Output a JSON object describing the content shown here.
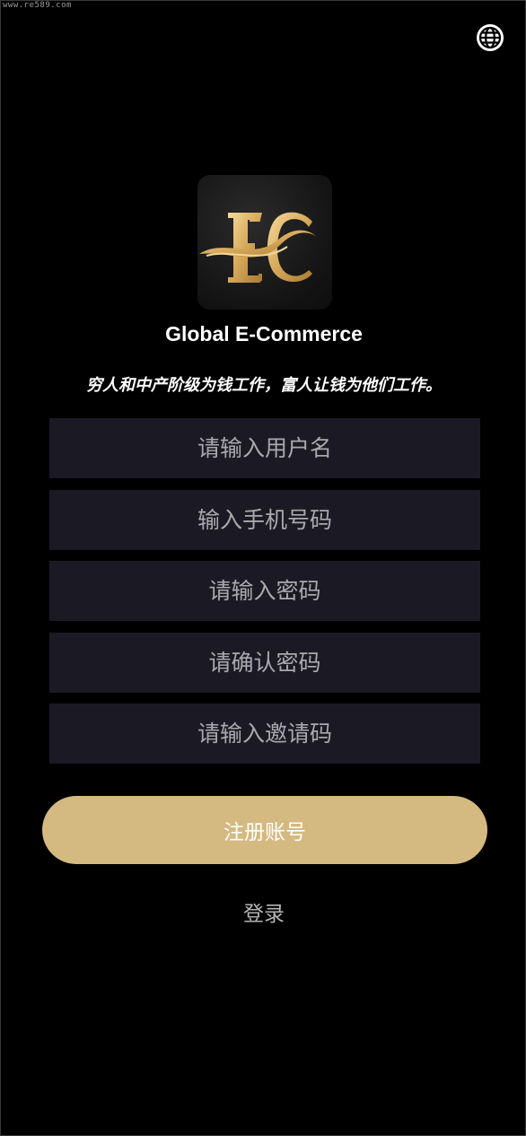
{
  "watermark": "www.re589.com",
  "header": {
    "language_icon": "globe-icon"
  },
  "app": {
    "logo_icon": "ec-logo",
    "logo_text": "EC",
    "name": "Global E-Commerce",
    "slogan": "穷人和中产阶级为钱工作，富人让钱为他们工作。"
  },
  "form": {
    "username": {
      "value": "",
      "placeholder": "请输入用户名"
    },
    "phone": {
      "value": "",
      "placeholder": "输入手机号码"
    },
    "password": {
      "value": "",
      "placeholder": "请输入密码"
    },
    "confirm_password": {
      "value": "",
      "placeholder": "请确认密码"
    },
    "invite_code": {
      "value": "",
      "placeholder": "请输入邀请码"
    }
  },
  "actions": {
    "register_label": "注册账号",
    "login_label": "登录"
  },
  "colors": {
    "background": "#000000",
    "field_bg": "#1b1a24",
    "accent_gold": "#d4b981",
    "placeholder": "#a9a9ad",
    "logo_gold": "#e2b96a"
  }
}
